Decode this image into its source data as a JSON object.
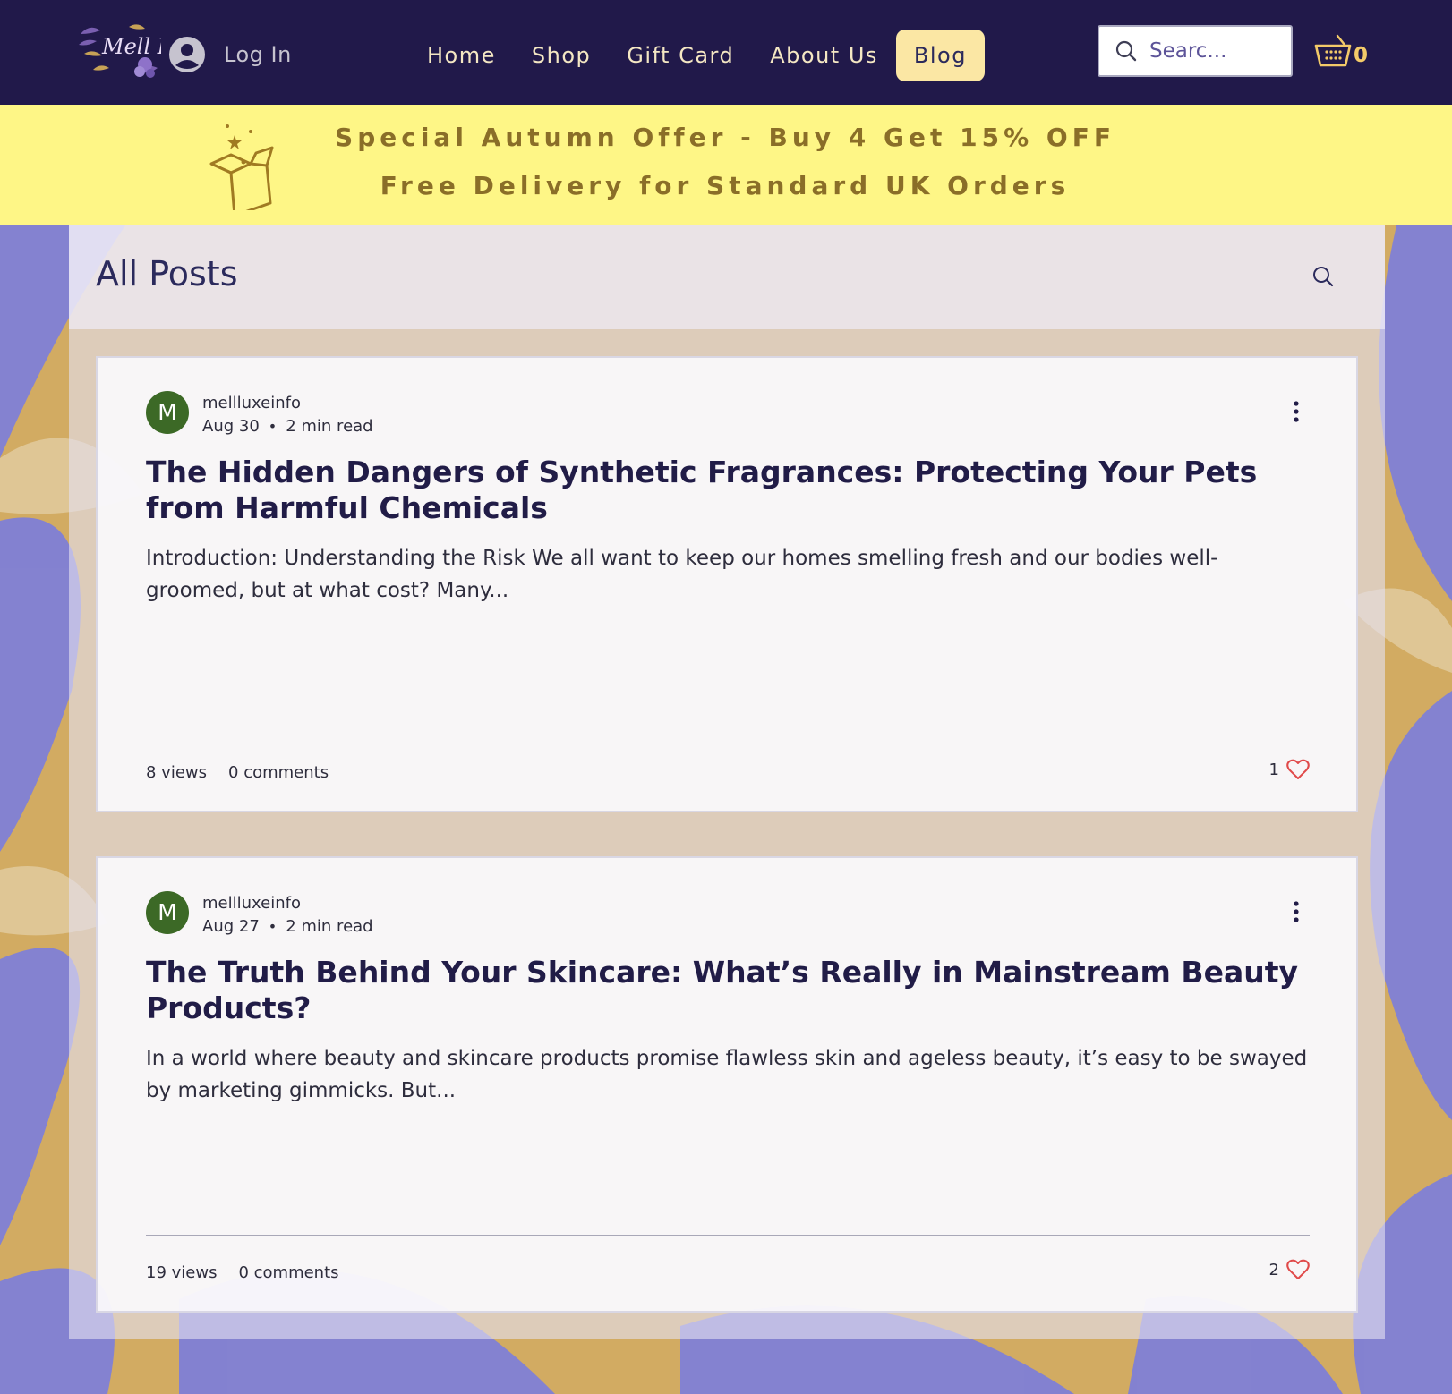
{
  "header": {
    "logo_text": "Mell Luxe",
    "login_label": "Log In",
    "nav": [
      {
        "label": "Home"
      },
      {
        "label": "Shop"
      },
      {
        "label": "Gift Card"
      },
      {
        "label": "About Us"
      },
      {
        "label": "Blog",
        "active": true
      }
    ],
    "search_placeholder": "Searc...",
    "cart_count": "0"
  },
  "promo": {
    "line1": "Special Autumn Offer - Buy 4 Get 15% OFF",
    "line2": "Free Delivery for Standard UK Orders"
  },
  "blog": {
    "title": "All Posts",
    "posts": [
      {
        "avatar_letter": "M",
        "author": "mellluxeinfo",
        "date": "Aug 30",
        "read_time": "2 min read",
        "title": "The Hidden Dangers of Synthetic Fragrances: Protecting Your Pets from Harmful Chemicals",
        "excerpt": "Introduction: Understanding the Risk We all want to keep our homes smelling fresh and our bodies well-groomed, but at what cost? Many...",
        "views": "8 views",
        "comments": "0 comments",
        "likes": "1"
      },
      {
        "avatar_letter": "M",
        "author": "mellluxeinfo",
        "date": "Aug 27",
        "read_time": "2 min read",
        "title": "The Truth Behind Your Skincare: What’s Really in Mainstream Beauty Products?",
        "excerpt": "In a world where beauty and skincare products promise flawless skin and ageless beauty, it’s easy to be swayed by marketing gimmicks. But...",
        "views": "19 views",
        "comments": "0 comments",
        "likes": "2"
      }
    ]
  },
  "colors": {
    "header_bg": "#21194a",
    "promo_bg": "#fef686",
    "promo_text": "#8a6e28",
    "nav_text": "#f4e7c3",
    "active_nav_bg": "#fbe7a4",
    "title_text": "#211c47",
    "avatar_bg": "#3c6926",
    "heart": "#e04a4a"
  },
  "icons": [
    "user-avatar-icon",
    "search-icon",
    "cart-icon",
    "gift-box-icon",
    "more-vertical-icon",
    "heart-icon"
  ]
}
